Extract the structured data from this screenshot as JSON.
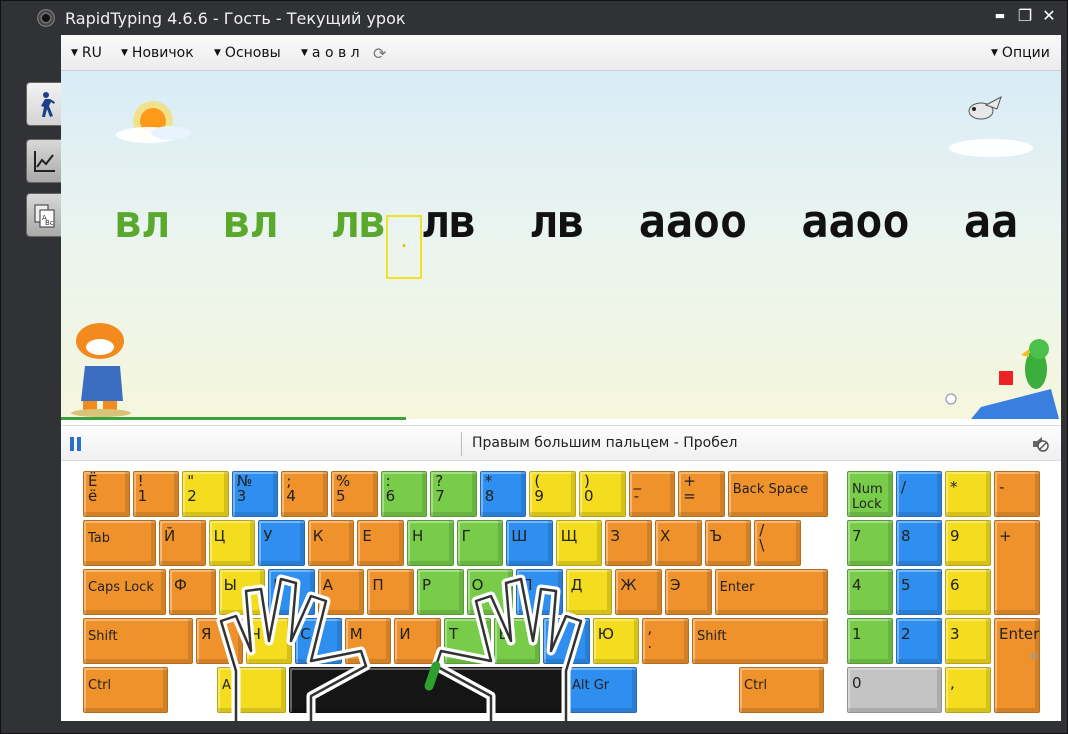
{
  "window": {
    "title": "RapidTyping 4.6.6 - Гость - Текущий урок"
  },
  "titlebar_buttons": {
    "minimize": "▬",
    "maximize": "❐",
    "close": "✕"
  },
  "sidebar": {
    "items": [
      {
        "icon": "walking-person-icon",
        "active": true
      },
      {
        "icon": "line-chart-icon",
        "active": false
      },
      {
        "icon": "lessons-cards-icon",
        "active": false
      }
    ]
  },
  "menubar": {
    "language": "RU",
    "level": "Новичок",
    "course": "Основы",
    "keys": "а о в л",
    "options": "Опции"
  },
  "lesson": {
    "typed_text": "вл  вл  лв",
    "cursor_char": "·",
    "remaining_text": "лв  лв  аaоо  аaоо  аа",
    "progress_percent": 34.5
  },
  "status": {
    "hint": "Правым большим пальцем - Пробел"
  },
  "colors": {
    "orange": "#f0922c",
    "yellow": "#f4dc1e",
    "blue": "#2f8ff0",
    "green": "#78cc4a",
    "typed_green": "#5aa82c",
    "progress_green": "#3aa23a"
  },
  "keyboard": {
    "row1": [
      {
        "top": "Ё",
        "bot": "ё",
        "color": "or"
      },
      {
        "top": "!",
        "bot": "1",
        "color": "or"
      },
      {
        "top": "\"",
        "bot": "2",
        "color": "ye"
      },
      {
        "top": "№",
        "bot": "3",
        "color": "bl"
      },
      {
        "top": ";",
        "bot": "4",
        "color": "or"
      },
      {
        "top": "%",
        "bot": "5",
        "color": "or"
      },
      {
        "top": ":",
        "bot": "6",
        "color": "gr"
      },
      {
        "top": "?",
        "bot": "7",
        "color": "gr"
      },
      {
        "top": "*",
        "bot": "8",
        "color": "bl"
      },
      {
        "top": "(",
        "bot": "9",
        "color": "ye"
      },
      {
        "top": ")",
        "bot": "0",
        "color": "ye"
      },
      {
        "top": "_",
        "bot": "-",
        "color": "or"
      },
      {
        "top": "+",
        "bot": "=",
        "color": "or"
      },
      {
        "label": "Back Space",
        "color": "or"
      }
    ],
    "row2": [
      {
        "label": "Tab",
        "color": "or"
      },
      {
        "single": "Й",
        "color": "or"
      },
      {
        "single": "Ц",
        "color": "ye"
      },
      {
        "single": "У",
        "color": "bl"
      },
      {
        "single": "К",
        "color": "or"
      },
      {
        "single": "Е",
        "color": "or"
      },
      {
        "single": "Н",
        "color": "gr"
      },
      {
        "single": "Г",
        "color": "gr"
      },
      {
        "single": "Ш",
        "color": "bl"
      },
      {
        "single": "Щ",
        "color": "ye"
      },
      {
        "single": "З",
        "color": "or"
      },
      {
        "single": "Х",
        "color": "or"
      },
      {
        "single": "Ъ",
        "color": "or"
      },
      {
        "top": "/",
        "bot": "\\",
        "color": "or"
      }
    ],
    "row3": [
      {
        "label": "Caps Lock",
        "color": "or"
      },
      {
        "single": "Ф",
        "color": "or"
      },
      {
        "single": "Ы",
        "color": "ye"
      },
      {
        "single": "В",
        "color": "bl"
      },
      {
        "single": "А",
        "color": "or"
      },
      {
        "single": "П",
        "color": "or"
      },
      {
        "single": "Р",
        "color": "gr"
      },
      {
        "single": "О",
        "color": "gr"
      },
      {
        "single": "Л",
        "color": "bl"
      },
      {
        "single": "Д",
        "color": "ye"
      },
      {
        "single": "Ж",
        "color": "or"
      },
      {
        "single": "Э",
        "color": "or"
      },
      {
        "label": "Enter",
        "color": "or"
      }
    ],
    "row4": [
      {
        "label": "Shift",
        "color": "or"
      },
      {
        "single": "Я",
        "color": "or"
      },
      {
        "single": "Ч",
        "color": "ye"
      },
      {
        "single": "С",
        "color": "bl"
      },
      {
        "single": "М",
        "color": "or"
      },
      {
        "single": "И",
        "color": "or"
      },
      {
        "single": "Т",
        "color": "gr"
      },
      {
        "single": "Ь",
        "color": "gr"
      },
      {
        "single": "Б",
        "color": "bl"
      },
      {
        "single": "Ю",
        "color": "ye"
      },
      {
        "top": ",",
        "bot": ".",
        "color": "or"
      },
      {
        "label": "Shift",
        "color": "or"
      }
    ],
    "row5": [
      {
        "label": "Ctrl",
        "color": "or"
      },
      {
        "label": "Alt",
        "color": "ye"
      },
      {
        "label": "",
        "color": "dk"
      },
      {
        "label": "Alt Gr",
        "color": "bl"
      },
      {
        "label": "Ctrl",
        "color": "or"
      }
    ],
    "numpad": [
      {
        "label": "Num Lock",
        "color": "gr"
      },
      {
        "single": "/",
        "color": "bl"
      },
      {
        "single": "*",
        "color": "ye"
      },
      {
        "single": "-",
        "color": "or"
      },
      {
        "single": "7",
        "color": "gr"
      },
      {
        "single": "8",
        "color": "bl"
      },
      {
        "single": "9",
        "color": "ye"
      },
      {
        "single": "+",
        "color": "or"
      },
      {
        "single": "4",
        "color": "gr"
      },
      {
        "single": "5",
        "color": "bl"
      },
      {
        "single": "6",
        "color": "ye"
      },
      {
        "single": "1",
        "color": "gr"
      },
      {
        "single": "2",
        "color": "bl"
      },
      {
        "single": "3",
        "color": "ye"
      },
      {
        "single": "Enter",
        "color": "or"
      },
      {
        "single": "0",
        "color": "gy"
      },
      {
        "single": ",",
        "color": "ye"
      }
    ]
  }
}
